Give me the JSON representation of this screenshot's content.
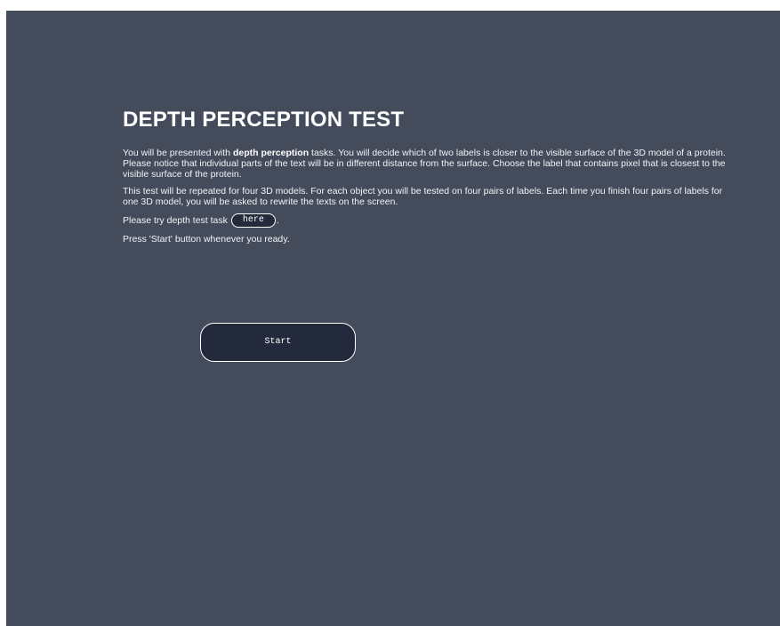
{
  "intro": {
    "title": "DEPTH PERCEPTION TEST",
    "p1_before": "You will be presented with ",
    "p1_bold": "depth perception",
    "p1_after": " tasks. You will decide which of two labels is closer to the visible surface of the 3D model of a protein. Please notice that individual parts of the text will be in different distance from the surface. Choose the label that contains pixel that is closest to the visible surface of the protein.",
    "p2": "This test will be repeated for four 3D models. For each object you will be tested on four pairs of labels. Each time you finish four pairs of labels for one 3D model, you will be asked to rewrite the texts on the screen.",
    "p3_before": "Please try depth test task ",
    "here_label": "here",
    "p3_after": ".",
    "p4": "Press 'Start' button whenever you ready."
  },
  "start_button": {
    "label": "Start"
  },
  "colors": {
    "background": "#444b5b",
    "button_fill": "#232a3b",
    "text": "#ffffff"
  }
}
